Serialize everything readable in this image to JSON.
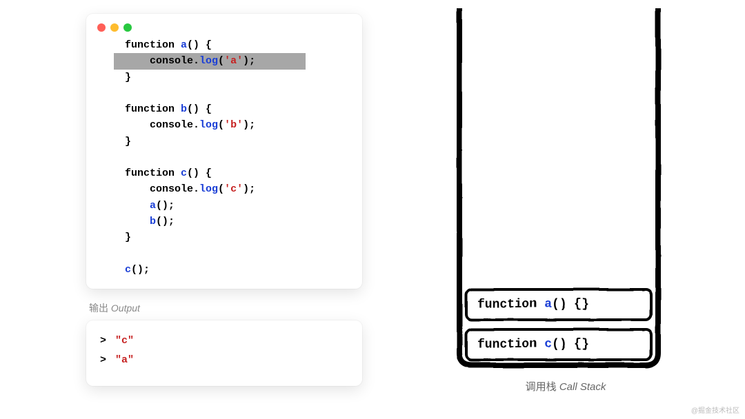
{
  "code": {
    "lines": [
      {
        "hl": false,
        "tokens": [
          {
            "t": "function ",
            "c": "kw"
          },
          {
            "t": "a",
            "c": "fn"
          },
          {
            "t": "() {",
            "c": "punct"
          }
        ]
      },
      {
        "hl": true,
        "tokens": [
          {
            "t": "    console.",
            "c": "kw"
          },
          {
            "t": "log",
            "c": "method"
          },
          {
            "t": "(",
            "c": "punct"
          },
          {
            "t": "'a'",
            "c": "str"
          },
          {
            "t": ");",
            "c": "punct"
          }
        ]
      },
      {
        "hl": false,
        "tokens": [
          {
            "t": "}",
            "c": "punct"
          }
        ]
      },
      {
        "hl": false,
        "tokens": [
          {
            "t": " ",
            "c": "punct"
          }
        ]
      },
      {
        "hl": false,
        "tokens": [
          {
            "t": "function ",
            "c": "kw"
          },
          {
            "t": "b",
            "c": "fn"
          },
          {
            "t": "() {",
            "c": "punct"
          }
        ]
      },
      {
        "hl": false,
        "tokens": [
          {
            "t": "    console.",
            "c": "kw"
          },
          {
            "t": "log",
            "c": "method"
          },
          {
            "t": "(",
            "c": "punct"
          },
          {
            "t": "'b'",
            "c": "str"
          },
          {
            "t": ");",
            "c": "punct"
          }
        ]
      },
      {
        "hl": false,
        "tokens": [
          {
            "t": "}",
            "c": "punct"
          }
        ]
      },
      {
        "hl": false,
        "tokens": [
          {
            "t": " ",
            "c": "punct"
          }
        ]
      },
      {
        "hl": false,
        "tokens": [
          {
            "t": "function ",
            "c": "kw"
          },
          {
            "t": "c",
            "c": "fn"
          },
          {
            "t": "() {",
            "c": "punct"
          }
        ]
      },
      {
        "hl": false,
        "tokens": [
          {
            "t": "    console.",
            "c": "kw"
          },
          {
            "t": "log",
            "c": "method"
          },
          {
            "t": "(",
            "c": "punct"
          },
          {
            "t": "'c'",
            "c": "str"
          },
          {
            "t": ");",
            "c": "punct"
          }
        ]
      },
      {
        "hl": false,
        "tokens": [
          {
            "t": "    ",
            "c": "punct"
          },
          {
            "t": "a",
            "c": "fn"
          },
          {
            "t": "();",
            "c": "punct"
          }
        ]
      },
      {
        "hl": false,
        "tokens": [
          {
            "t": "    ",
            "c": "punct"
          },
          {
            "t": "b",
            "c": "fn"
          },
          {
            "t": "();",
            "c": "punct"
          }
        ]
      },
      {
        "hl": false,
        "tokens": [
          {
            "t": "}",
            "c": "punct"
          }
        ]
      },
      {
        "hl": false,
        "tokens": [
          {
            "t": " ",
            "c": "punct"
          }
        ]
      },
      {
        "hl": false,
        "tokens": [
          {
            "t": "c",
            "c": "fn"
          },
          {
            "t": "();",
            "c": "punct"
          }
        ]
      }
    ]
  },
  "output_label": {
    "cn": "输出",
    "en": "Output"
  },
  "output": [
    {
      "prompt": ">",
      "value": "\"c\""
    },
    {
      "prompt": ">",
      "value": "\"a\""
    }
  ],
  "stack": {
    "frames": [
      {
        "prefix": "function ",
        "name": "a",
        "suffix": "() {}"
      },
      {
        "prefix": "function ",
        "name": "c",
        "suffix": "() {}"
      }
    ],
    "label": {
      "cn": "调用栈",
      "en": "Call Stack"
    }
  },
  "watermark": "@掘金技术社区"
}
